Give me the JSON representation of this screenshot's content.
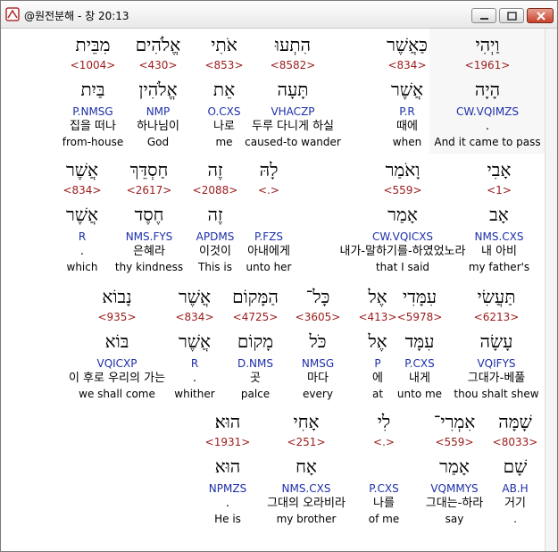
{
  "window": {
    "title": "@원전분해 - 창 20:13"
  },
  "words": [
    {
      "id": "w1",
      "heb1": "וַיְהִי",
      "num": "<1961>",
      "heb2": "הָיָה",
      "morph": "CW.VQIMZS",
      "kor": ".",
      "eng": "And it came to pass"
    },
    {
      "id": "w2",
      "heb1": "כַּאֲשֶׁר",
      "num": "<834>",
      "heb2": "אֲשֶׁר",
      "morph": "P.R",
      "kor": "때에",
      "eng": "when"
    },
    {
      "id": "w3",
      "heb1": "הִתְעוּ",
      "num": "<8582>",
      "heb2": "תָּעָה",
      "morph": "VHACZP",
      "kor": "두루 다니게 하실",
      "eng": "caused-to wander"
    },
    {
      "id": "w4",
      "heb1": "אֹתִי",
      "num": "<853>",
      "heb2": "אֵת",
      "morph": "O.CXS",
      "kor": "나로",
      "eng": "me"
    },
    {
      "id": "w5",
      "heb1": "אֱלֹהִים",
      "num": "<430>",
      "heb2": "אֱלֹהִין",
      "morph": "NMP",
      "kor": "하나님이",
      "eng": "God"
    },
    {
      "id": "w6",
      "heb1": "מִבֵּית",
      "num": "<1004>",
      "heb2": "בַּיִת",
      "morph": "P.NMSG",
      "kor": "집을 떠나",
      "eng": "from-house"
    },
    {
      "id": "w7",
      "heb1": "אָבִי",
      "num": "<1>",
      "heb2": "אָב",
      "morph": "NMS.CXS",
      "kor": "내 아비",
      "eng": "my father's"
    },
    {
      "id": "w8",
      "heb1": "וָאֹמַר",
      "num": "<559>",
      "heb2": "אָמַר",
      "morph": "CW.VQICXS",
      "kor": "내가-말하기를-하였었노라",
      "eng": "that I said"
    },
    {
      "id": "w9",
      "heb1": "לָהּ",
      "num": "<.>",
      "heb2": "",
      "morph": "P.FZS",
      "kor": "아내에게",
      "eng": "unto her"
    },
    {
      "id": "w10",
      "heb1": "זֶה",
      "num": "<2088>",
      "heb2": "זֶה",
      "morph": "APDMS",
      "kor": "이것이",
      "eng": "This is"
    },
    {
      "id": "w11",
      "heb1": "חַסְדֵּךְ",
      "num": "<2617>",
      "heb2": "חֶסֶד",
      "morph": "NMS.FYS",
      "kor": "은혜라",
      "eng": "thy kindness"
    },
    {
      "id": "w12",
      "heb1": "אֲשֶׁר",
      "num": "<834>",
      "heb2": "אֲשֶׁר",
      "morph": "R",
      "kor": ".",
      "eng": "which"
    },
    {
      "id": "w13",
      "heb1": "תַּעֲשִׂי",
      "num": "<6213>",
      "heb2": "עָשָׂה",
      "morph": "VQIFYS",
      "kor": "그대가-베풀",
      "eng": "thou shalt shew"
    },
    {
      "id": "w14",
      "heb1": "עִמָּדִי",
      "num": "<5978>",
      "heb2": "עִמָּד",
      "morph": "P.CXS",
      "kor": "내게",
      "eng": "unto me"
    },
    {
      "id": "w15",
      "heb1": "אֶל",
      "num": "<413>",
      "heb2": "אֶל",
      "morph": "P",
      "kor": "에",
      "eng": "at"
    },
    {
      "id": "w16",
      "heb1": "כָּל־",
      "num": "<3605>",
      "heb2": "כֹּל",
      "morph": "NMSG",
      "kor": "마다",
      "eng": "every"
    },
    {
      "id": "w17",
      "heb1": "הַמָּקוֹם",
      "num": "<4725>",
      "heb2": "מָקוֹם",
      "morph": "D.NMS",
      "kor": "곳",
      "eng": "palce"
    },
    {
      "id": "w18",
      "heb1": "אֲשֶׁר",
      "num": "<834>",
      "heb2": "אֲשֶׁר",
      "morph": "R",
      "kor": ".",
      "eng": "whither"
    },
    {
      "id": "w19",
      "heb1": "נָבוֹא",
      "num": "<935>",
      "heb2": "בּוֹא",
      "morph": "VQICXP",
      "kor": "이 후로 우리의 가는",
      "eng": "we shall come"
    },
    {
      "id": "w20",
      "heb1": "שָׁמָּה",
      "num": "<8033>",
      "heb2": "שָׁם",
      "morph": "AB.H",
      "kor": "거기",
      "eng": "."
    },
    {
      "id": "w21",
      "heb1": "אִמְרִי־",
      "num": "<559>",
      "heb2": "אָמַר",
      "morph": "VQMMYS",
      "kor": "그대는-하라",
      "eng": "say"
    },
    {
      "id": "w22",
      "heb1": "לִי",
      "num": "<.>",
      "heb2": "",
      "morph": "P.CXS",
      "kor": "나를",
      "eng": "of me"
    },
    {
      "id": "w23",
      "heb1": "אָחִי",
      "num": "<251>",
      "heb2": "אָח",
      "morph": "NMS.CXS",
      "kor": "그대의 오라비라",
      "eng": "my brother"
    },
    {
      "id": "w24",
      "heb1": "הוּא׃",
      "num": "<1931>",
      "heb2": "הוּא",
      "morph": "NPMZS",
      "kor": ".",
      "eng": "He is"
    }
  ]
}
